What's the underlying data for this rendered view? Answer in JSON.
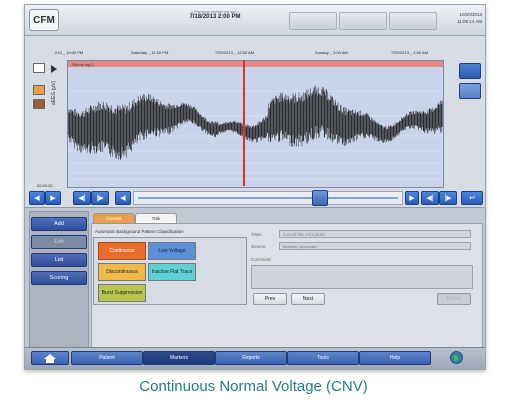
{
  "header": {
    "app_logo": "CFM",
    "subtitle": "< Previous review not set >",
    "current_datetime": "7/18/2013 2:00 PM",
    "clock_date": "10/20/2013",
    "clock_time": "11:05:14 AM"
  },
  "timeline": {
    "labels": [
      "013 _ 10:00 PM",
      "Saturday _ 11:00 PM",
      "7/20/2013 _ 12:00 AM",
      "Sunday _ 1:00 AM",
      "7/20/2013 _ 1:00 AM"
    ]
  },
  "plot": {
    "y_axis_label": "aEEG (μV)",
    "timestamp": "00:00:20",
    "event_marker_label": "Seizure tag: 0"
  },
  "tabs": [
    {
      "label": "Current"
    },
    {
      "label": "Trak"
    }
  ],
  "sidebar": {
    "items": [
      {
        "label": "Add"
      },
      {
        "label": "Edit"
      },
      {
        "label": "List"
      },
      {
        "label": "Scoring"
      }
    ]
  },
  "classification": {
    "title": "Automatic Background Pattern Classification",
    "buttons": [
      {
        "label": "Continuous",
        "color": "#e86c2c"
      },
      {
        "label": "Low Voltage",
        "color": "#5b8fd9"
      },
      {
        "label": "Discontinuous",
        "color": "#f0b94a"
      },
      {
        "label": "Inactive Flat Trace",
        "color": "#5ed1d7"
      },
      {
        "label": "Burst Suppression",
        "color": "#b6c64f"
      }
    ]
  },
  "details": {
    "time_label": "Time:",
    "time_value": "9:40:33 PM, 0:21:05:00",
    "source_label": "Source:",
    "source_value": "Bedside, Automatic",
    "comment_label": "Comment:",
    "prev_label": "Prev",
    "next_label": "Next",
    "delete_label": "Delete"
  },
  "bottom_nav": {
    "items": [
      {
        "label": "Patient"
      },
      {
        "label": "Markers"
      },
      {
        "label": "Reports"
      },
      {
        "label": "Tools"
      },
      {
        "label": "Help"
      }
    ]
  },
  "caption": "Continuous Normal Voltage (CNV)"
}
